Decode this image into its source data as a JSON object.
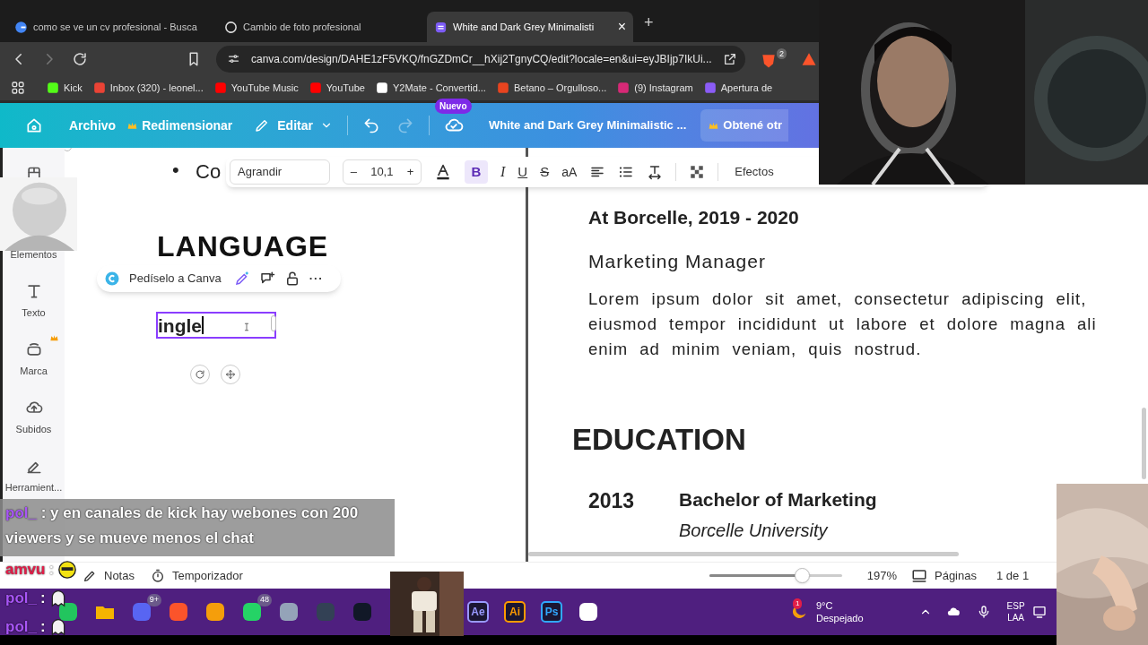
{
  "browser": {
    "tabs": [
      {
        "title": "como se ve un cv profesional - Busca",
        "kind": "search",
        "selected": false
      },
      {
        "title": "Cambio de foto profesional",
        "kind": "chat",
        "selected": false
      },
      {
        "title": "White and Dark Grey Minimalisti",
        "kind": "design",
        "selected": true
      }
    ],
    "close": "×",
    "new_tab": "+",
    "url": "canva.com/design/DAHE1zF5VKQ/fnGZDmCr__hXij2TgnyCQ/edit?locale=en&ui=eyJBIjp7IkUi...",
    "extension_badge": "2",
    "bookmarks": [
      {
        "label": "Kick",
        "color": "#53fc18"
      },
      {
        "label": "Inbox (320) - leonel...",
        "color": "#ea4335"
      },
      {
        "label": "YouTube Music",
        "color": "#ff0000"
      },
      {
        "label": "YouTube",
        "color": "#ff0000"
      },
      {
        "label": "Y2Mate - Convertid...",
        "color": "#ffffff"
      },
      {
        "label": "Betano – Orgulloso...",
        "color": "#e8441f"
      },
      {
        "label": "(9) Instagram",
        "color": "#d62976"
      },
      {
        "label": "Apertura de",
        "color": "#8b5cf6"
      }
    ]
  },
  "editor_header": {
    "file_menu": "Archivo",
    "resize": "Redimensionar",
    "edit": "Editar",
    "redo_disabled": true,
    "new_badge": "Nuevo",
    "title": "White and Dark Grey Minimalistic ...",
    "upgrade": "Obtené otr"
  },
  "sidebar": [
    {
      "kind": "design"
    },
    {
      "kind": "elements",
      "label": "Elementos"
    },
    {
      "kind": "text",
      "label": "Texto"
    },
    {
      "kind": "brand",
      "label": "Marca",
      "premium": true
    },
    {
      "kind": "uploads",
      "label": "Subidos"
    },
    {
      "kind": "tools",
      "label": "Herramient..."
    }
  ],
  "text_toolbar": {
    "font": "Agrandir",
    "minus": "–",
    "size": "10,1",
    "plus": "+",
    "bold": "B",
    "bold_on": true,
    "italic": "I",
    "underline": "U",
    "strike": "S",
    "case": "aA",
    "effects": "Efectos"
  },
  "ai_toolbar": {
    "label": "Pedíselo a Canva",
    "more": "···"
  },
  "left_page": {
    "bullet": "•",
    "bullet_text": "Co",
    "heading": "LANGUAGE",
    "editing_text": "ingle"
  },
  "right_page": {
    "job_title": "At Borcelle,  2019 - 2020",
    "role": "Marketing Manager",
    "paragraph_lines": [
      "Lorem ipsum dolor sit amet, consectetur adipiscing elit,",
      "eiusmod tempor incididunt ut labore et dolore magna ali",
      "enim ad minim veniam, quis nostrud."
    ],
    "section": "EDUCATION",
    "year": "2013",
    "degree": "Bachelor of  Marketing",
    "school": "Borcelle University"
  },
  "footer": {
    "notes": "Notas",
    "timer": "Temporizador",
    "zoom": {
      "level": 0.73
    },
    "zoom_value": "197%",
    "pages": "Páginas",
    "page_count": "1 de 1"
  },
  "chat": {
    "panel": [
      {
        "user": "pol_",
        "separator": ":",
        "color": "#a855f7",
        "text": "y en canales de kick hay webones con 200 viewers y se mueve menos el chat"
      }
    ],
    "loose": [
      {
        "user": "amvu",
        "separator": ":",
        "color": "#e11d48",
        "kind": "sunglasses"
      },
      {
        "user": "pol_",
        "separator": ":",
        "color": "#a855f7",
        "kind": "ghost"
      },
      {
        "user": "pol_",
        "separator": ":",
        "color": "#a855f7",
        "kind": "ghost"
      }
    ]
  },
  "taskbar": {
    "apps": [
      {
        "kind": "shape",
        "color": "#22c55e"
      },
      {
        "kind": "folder",
        "color": "#f5b400"
      },
      {
        "kind": "shape",
        "color": "#5865f2",
        "badge": "9+"
      },
      {
        "kind": "shape",
        "color": "#fb542b"
      },
      {
        "kind": "shape",
        "color": "#f59e0b"
      },
      {
        "kind": "shape",
        "color": "#25d366",
        "badge": "48"
      },
      {
        "kind": "shape",
        "color": "#94a3b8"
      },
      {
        "kind": "shape",
        "color": "#334155"
      },
      {
        "kind": "shape",
        "color": "#111827"
      },
      {
        "kind": "label",
        "label": "Ae",
        "color": "#9999ff"
      },
      {
        "kind": "label",
        "label": "Ai",
        "color": "#ff9a00"
      },
      {
        "kind": "label",
        "label": "Ps",
        "color": "#31a8ff"
      },
      {
        "kind": "shape",
        "color": "#ffffff"
      }
    ],
    "weather_badge": "1",
    "temperature": "9°C",
    "weather": "Despejado",
    "language": "ESP",
    "layout": "LAA"
  }
}
